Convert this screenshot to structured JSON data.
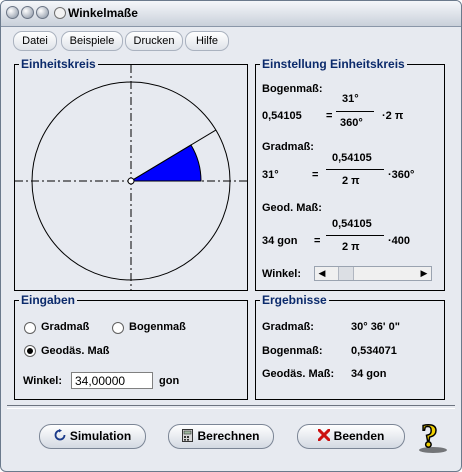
{
  "window": {
    "title": "Winkelmaße"
  },
  "menu": [
    {
      "label": "Datei"
    },
    {
      "label": "Beispiele"
    },
    {
      "label": "Drucken"
    },
    {
      "label": "Hilfe"
    }
  ],
  "einheitskreis": {
    "title": "Einheitskreis",
    "angle_deg": 31,
    "angle_fraction_of_circle": 0.0861
  },
  "einstellung": {
    "title": "Einstellung Einheitskreis",
    "bogen_label": "Bogenmaß:",
    "bogen_value": "0,54105",
    "bogen_eq": "=",
    "bogen_num": "31°",
    "bogen_den": "360°",
    "bogen_factor": "·2 π",
    "grad_label": "Gradmaß:",
    "grad_value": "31°",
    "grad_eq": "=",
    "grad_num": "0,54105",
    "grad_den": "2 π",
    "grad_factor": "·360°",
    "geod_label": "Geod. Maß:",
    "geod_value": "34 gon",
    "geod_eq": "=",
    "geod_num": "0,54105",
    "geod_den": "2 π",
    "geod_factor": "·400",
    "winkel_label": "Winkel:",
    "slider_position": 0.1
  },
  "eingaben": {
    "title": "Eingaben",
    "radio_grad": "Gradmaß",
    "radio_bogen": "Bogenmaß",
    "radio_geod": "Geodäs. Maß",
    "winkel_label": "Winkel:",
    "winkel_value": "34,00000",
    "winkel_unit": "gon"
  },
  "ergebnisse": {
    "title": "Ergebnisse",
    "rows": [
      {
        "label": "Gradmaß:",
        "value": "30° 36' 0\""
      },
      {
        "label": "Bogenmaß:",
        "value": "0,534071"
      },
      {
        "label": "Geodäs. Maß:",
        "value": "34 gon"
      }
    ]
  },
  "buttons": {
    "simulation": "Simulation",
    "berechnen": "Berechnen",
    "beenden": "Beenden",
    "help_glyph": "?"
  },
  "colors": {
    "sector": "#0000ff",
    "title_text": "#0b2a6b"
  }
}
